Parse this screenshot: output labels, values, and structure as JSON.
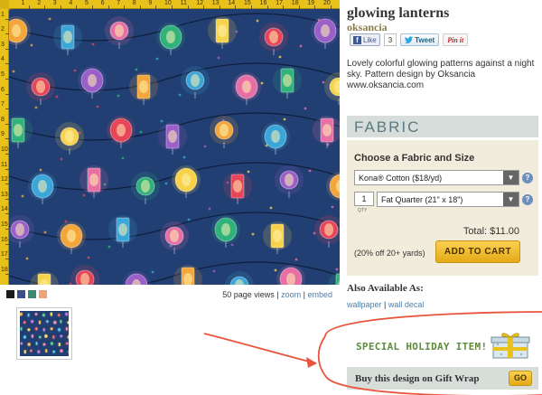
{
  "ruler": {
    "top_numbers": [
      "1",
      "2",
      "3",
      "4",
      "5",
      "6",
      "7",
      "8",
      "9",
      "10",
      "11",
      "12",
      "13",
      "14",
      "15",
      "16",
      "17",
      "18",
      "19",
      "20"
    ],
    "left_numbers": [
      "1",
      "2",
      "3",
      "4",
      "5",
      "6",
      "7",
      "8",
      "9",
      "10",
      "11",
      "12",
      "13",
      "14",
      "15",
      "16",
      "17",
      "18"
    ]
  },
  "pattern": {
    "background_color": "#213f73",
    "lantern_colors": [
      "#f5a63b",
      "#e8445a",
      "#2fb37b",
      "#3aa6d9",
      "#9b5fc9",
      "#f7d24b",
      "#e86fa6"
    ]
  },
  "swatches": [
    "#1b1b1b",
    "#3d4f8a",
    "#3d8a74",
    "#f0a17a"
  ],
  "views": {
    "count_text": "50 page views",
    "sep1": " | ",
    "zoom_label": "zoom",
    "sep2": " | ",
    "embed_label": "embed"
  },
  "design": {
    "title": "glowing lanterns",
    "designer": "oksancia",
    "description": "Lovely colorful glowing patterns against a night sky. Pattern design by Oksancia www.oksancia.com"
  },
  "social": {
    "fb_icon": "f",
    "fb_label": "Like",
    "fb_count": "3",
    "tweet_label": "Tweet",
    "pin_label": "Pin it"
  },
  "fabric": {
    "header": "FABRIC",
    "choose_label": "Choose a Fabric and Size",
    "fabric_selected": "Kona® Cotton ($18/yd)",
    "qty_value": "1",
    "qty_label": "QTY",
    "size_selected": "Fat Quarter (21\" x 18\")",
    "total": "Total: $11.00",
    "discount": "(20% off 20+ yards)",
    "cart_button": "ADD TO CART",
    "help_icon": "?"
  },
  "also_available": {
    "heading": "Also Available As:",
    "wallpaper": "wallpaper",
    "separator": " | ",
    "wall_decal": "wall decal"
  },
  "holiday": {
    "banner": "SPECIAL HOLIDAY ITEM!",
    "giftwrap_text": "Buy this design on Gift Wrap",
    "go_button": "GO"
  },
  "annotation_color": "#e8543c"
}
